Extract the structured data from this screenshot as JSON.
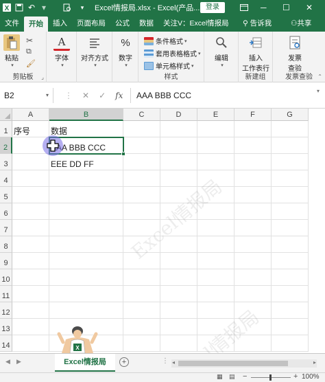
{
  "titlebar": {
    "file_name": "Excel情报局.xlsx",
    "separator": " - ",
    "app_name": "Excel(产品...",
    "login": "登录"
  },
  "ribbon_tabs": [
    "文件",
    "开始",
    "插入",
    "页面布局",
    "公式",
    "数据",
    "关注V：Excel情报局"
  ],
  "ribbon_tab_active_index": 1,
  "tell_me": "告诉我",
  "share": "共享",
  "ribbon": {
    "paste": "粘贴",
    "clipboard": "剪贴板",
    "font": "字体",
    "alignment": "对齐方式",
    "number": "数字",
    "cond_format": "条件格式",
    "table_format": "套用表格格式",
    "cell_style": "单元格样式",
    "styles": "样式",
    "edit": "编辑",
    "insert_row_line1": "插入",
    "insert_row_line2": "工作表行",
    "new_group": "新建组",
    "invoice_line1": "发票",
    "invoice_line2": "查验",
    "invoice_group": "发票查验"
  },
  "formula_bar": {
    "name_box": "B2",
    "fx": "fx",
    "formula": "AAA BBB CCC"
  },
  "columns": [
    "A",
    "B",
    "C",
    "D",
    "E",
    "F",
    "G"
  ],
  "selected_column": "B",
  "rows": [
    "1",
    "2",
    "3",
    "4",
    "5",
    "6",
    "7",
    "8",
    "9",
    "10",
    "11",
    "12",
    "13",
    "14"
  ],
  "selected_row": "2",
  "cells": {
    "A1": "序号",
    "B1": "数据",
    "B2": "AAA BBB CCC",
    "B3": "EEE DD FF"
  },
  "watermark": "Excel情报局",
  "sheet_tab": "Excel情报局",
  "zoom": "100%",
  "colors": {
    "accent": "#217346",
    "cursor_halo": "#786ee6"
  }
}
